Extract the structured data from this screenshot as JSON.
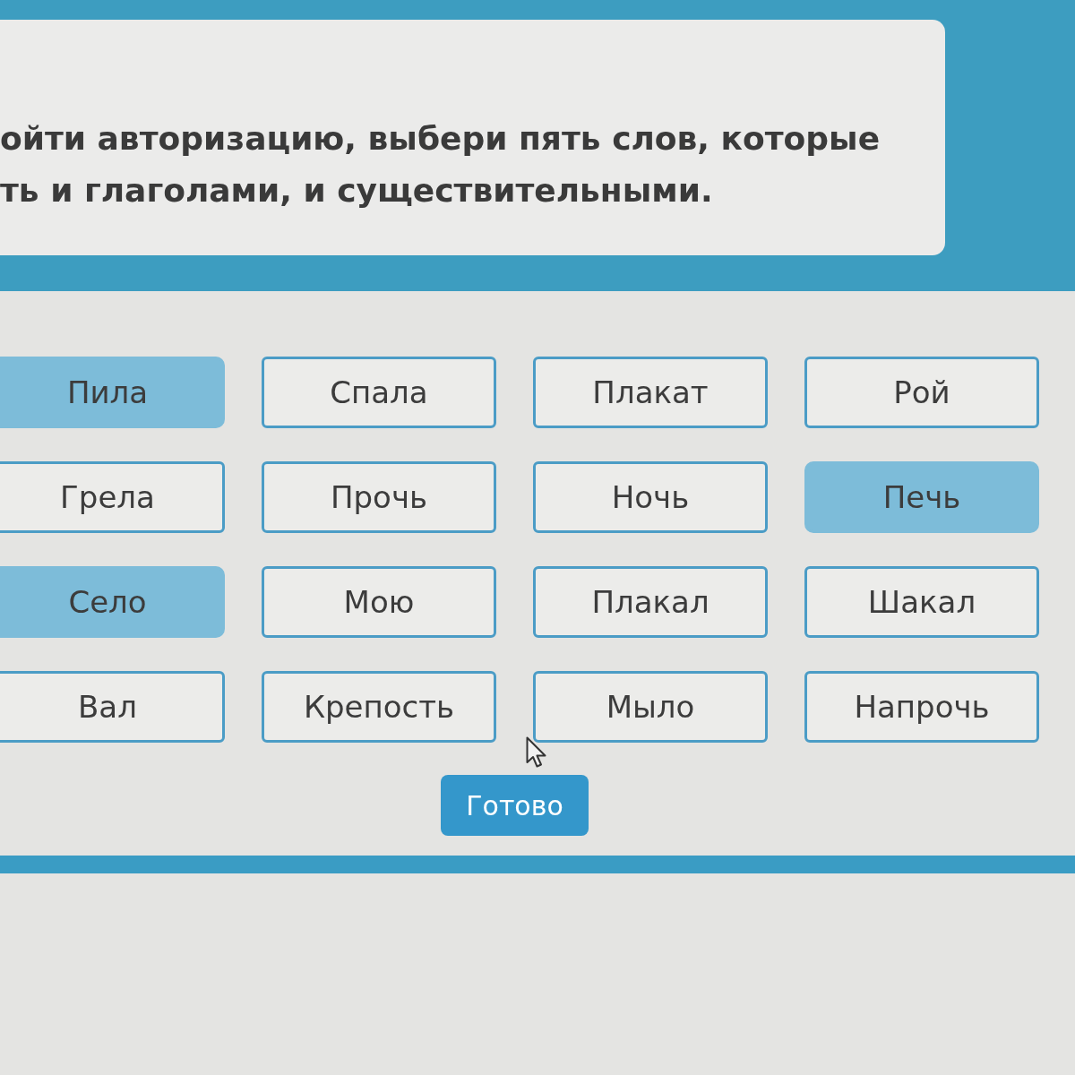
{
  "instruction": {
    "lines": [
      "ойти авторизацию, выбери пять слов, которые",
      "ть и глаголами, и существительными."
    ]
  },
  "words": [
    {
      "label": "Пила",
      "selected": true
    },
    {
      "label": "Спала",
      "selected": false
    },
    {
      "label": "Плакат",
      "selected": false
    },
    {
      "label": "Рой",
      "selected": false
    },
    {
      "label": "Грела",
      "selected": false
    },
    {
      "label": "Прочь",
      "selected": false
    },
    {
      "label": "Ночь",
      "selected": false
    },
    {
      "label": "Печь",
      "selected": true
    },
    {
      "label": "Село",
      "selected": true
    },
    {
      "label": "Мою",
      "selected": false
    },
    {
      "label": "Плакал",
      "selected": false
    },
    {
      "label": "Шакал",
      "selected": false
    },
    {
      "label": "Вал",
      "selected": false
    },
    {
      "label": "Крепость",
      "selected": false
    },
    {
      "label": "Мыло",
      "selected": false
    },
    {
      "label": "Напрочь",
      "selected": false
    }
  ],
  "done_button": {
    "label": "Готово"
  }
}
